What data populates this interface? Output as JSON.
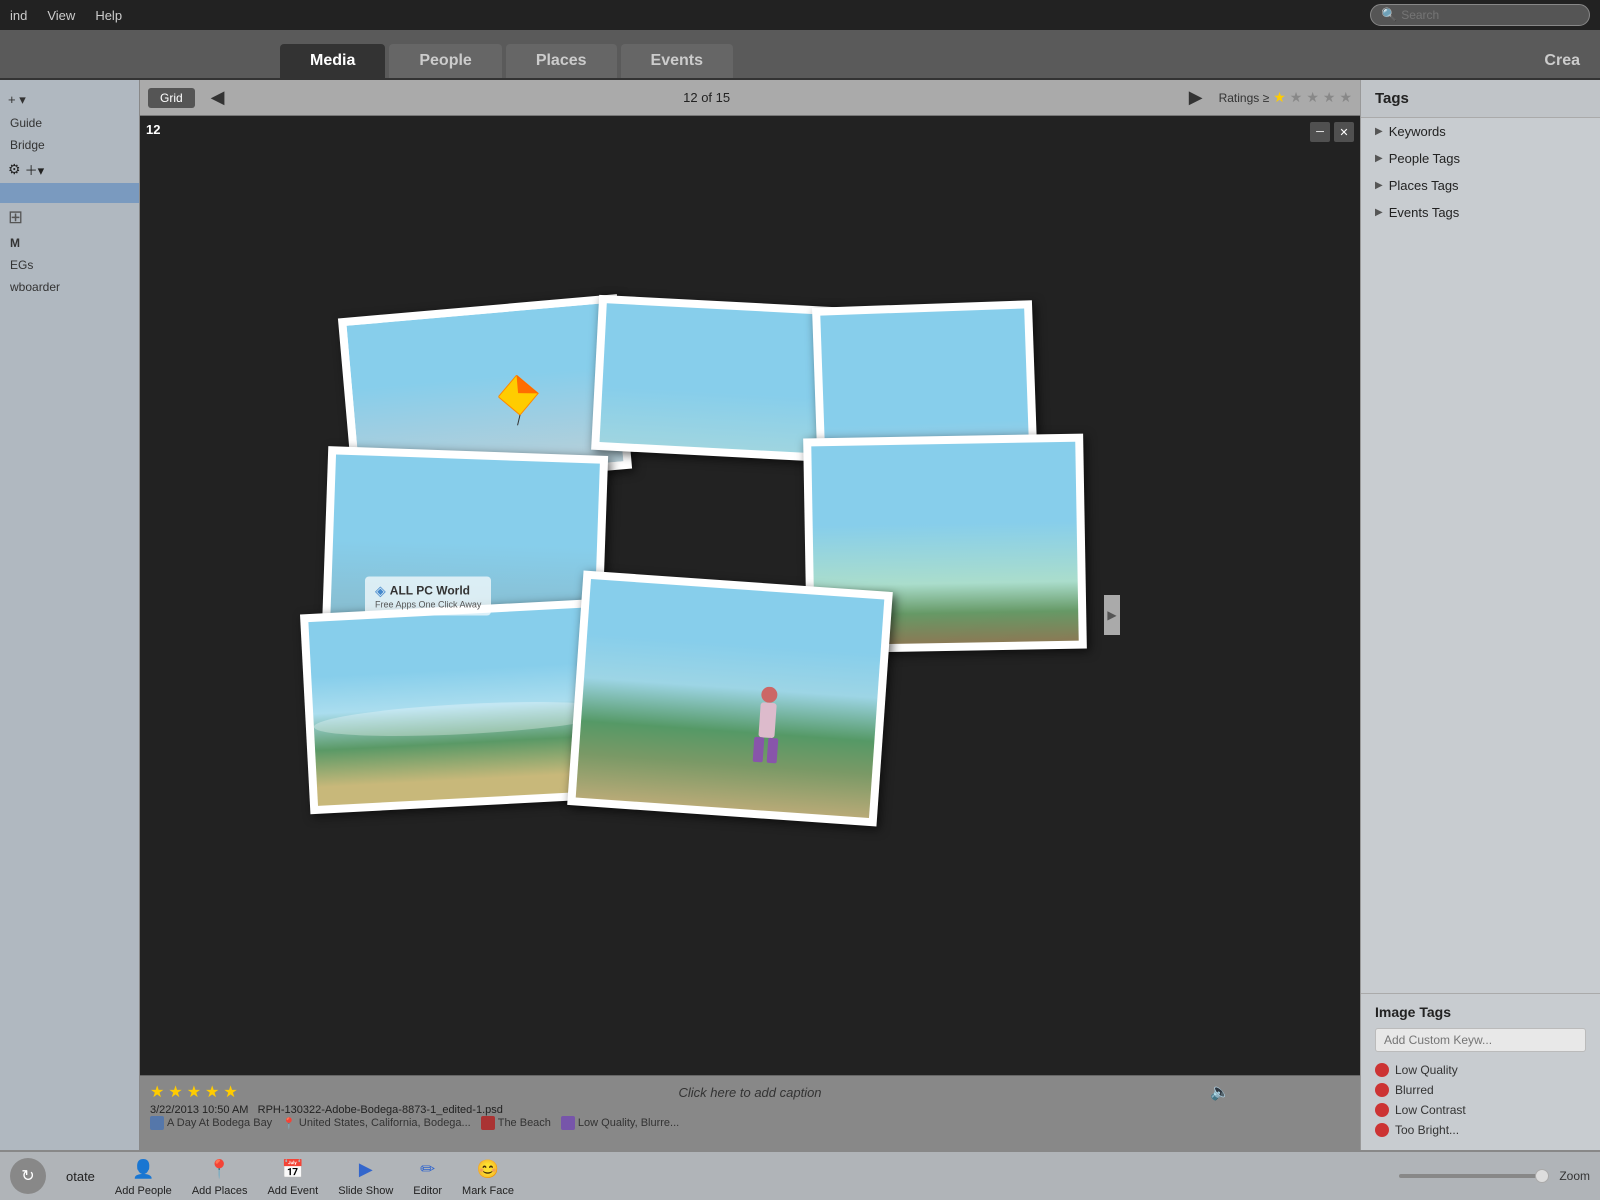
{
  "menubar": {
    "items": [
      "ind",
      "View",
      "Help"
    ],
    "search_placeholder": "Search"
  },
  "tabs": [
    {
      "label": "Media",
      "active": false
    },
    {
      "label": "People",
      "active": true
    },
    {
      "label": "Places",
      "active": false
    },
    {
      "label": "Events",
      "active": false
    }
  ],
  "create_label": "Crea",
  "toolbar": {
    "grid_label": "Grid",
    "nav_prev": "◀",
    "nav_next": "▶",
    "page_info": "12 of 15",
    "ratings_label": "Ratings ≥",
    "stars": [
      "★",
      "★",
      "★",
      "★",
      "★"
    ]
  },
  "image": {
    "number": "12",
    "caption": "Click here to add caption",
    "ctrl_min": "─",
    "ctrl_close": "✕",
    "stars": [
      "★",
      "★",
      "★",
      "★",
      "★"
    ],
    "date": "3/22/2013 10:50 AM",
    "filename": "RPH-130322-Adobe-Bodega-8873-1_edited-1.psd",
    "tags": [
      {
        "icon": "blue",
        "label": "A Day At Bodega Bay"
      },
      {
        "icon": "location",
        "label": "United States, California, Bodega..."
      },
      {
        "icon": "red",
        "label": "The Beach"
      },
      {
        "icon": "purple",
        "label": "Low Quality, Blurre..."
      }
    ]
  },
  "watermark": {
    "title": "ALL PC World",
    "subtitle": "Free Apps One Click Away"
  },
  "right_sidebar": {
    "title": "Tags",
    "sections": [
      {
        "label": "Keywords"
      },
      {
        "label": "People Tags"
      },
      {
        "label": "Places Tags"
      },
      {
        "label": "Events Tags"
      }
    ],
    "image_tags_title": "Image Tags",
    "keyword_placeholder": "Add Custom Keyw...",
    "tag_items": [
      {
        "color": "#cc3333",
        "label": "Low Quality"
      },
      {
        "color": "#cc3333",
        "label": "Blurred"
      },
      {
        "color": "#cc3333",
        "label": "Low Contrast"
      },
      {
        "color": "#cc3333",
        "label": "Too Bright..."
      }
    ]
  },
  "left_sidebar": {
    "add_label": "+ ▾",
    "items": [
      {
        "label": "Guide"
      },
      {
        "label": ""
      },
      {
        "label": "Bridge"
      }
    ],
    "sub_items": [
      {
        "label": "EGs"
      },
      {
        "label": "wboarder"
      }
    ]
  },
  "bottom_toolbar": {
    "rotate_label": "otate",
    "buttons": [
      {
        "icon": "👤+",
        "label": "Add People"
      },
      {
        "icon": "📍+",
        "label": "Add Places"
      },
      {
        "icon": "1+",
        "label": "Add Event"
      },
      {
        "icon": "▶",
        "label": "Slide Show"
      },
      {
        "icon": "✎",
        "label": "Editor"
      },
      {
        "icon": "👤",
        "label": "Mark Face"
      }
    ],
    "zoom_label": "Zoom"
  }
}
